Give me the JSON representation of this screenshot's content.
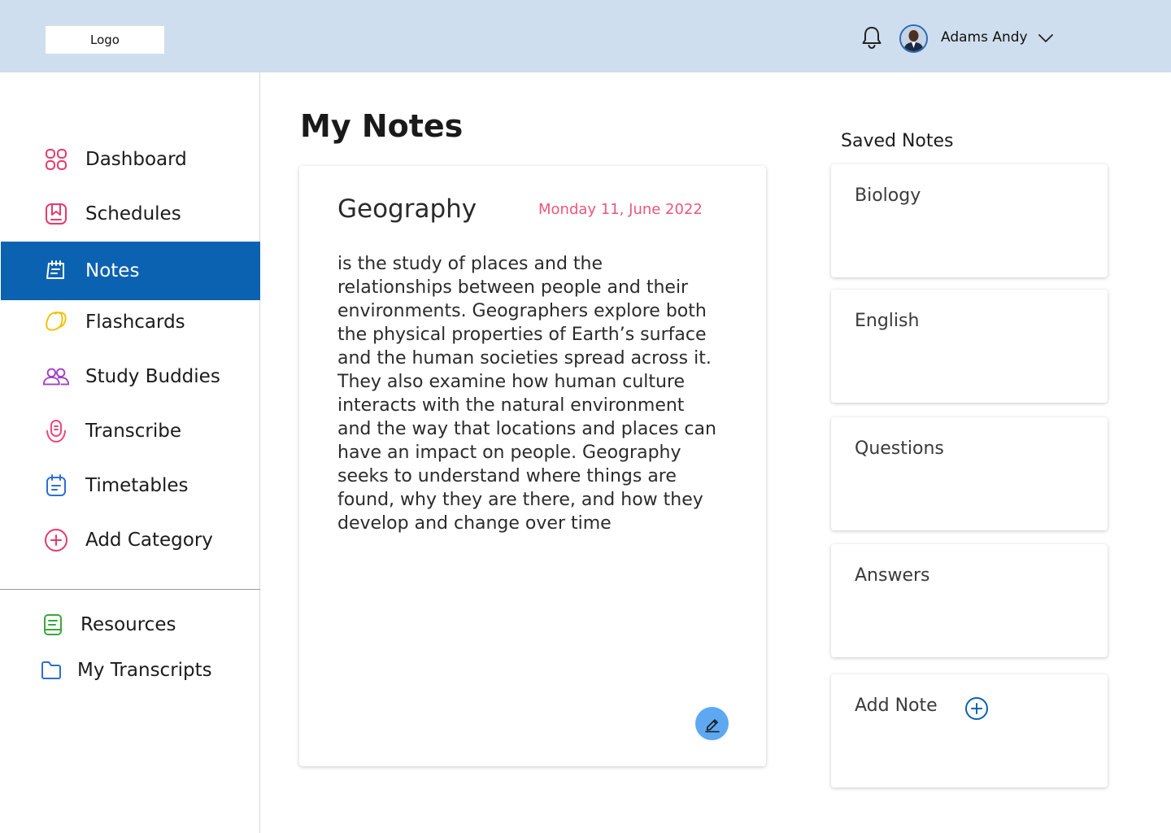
{
  "header": {
    "logo": "Logo",
    "user_name": "Adams Andy"
  },
  "sidebar": {
    "items": [
      {
        "label": "Dashboard",
        "icon": "grid-icon"
      },
      {
        "label": "Schedules",
        "icon": "calendar-bookmark-icon"
      },
      {
        "label": "Notes",
        "icon": "notes-icon"
      },
      {
        "label": "Flashcards",
        "icon": "flashcards-icon"
      },
      {
        "label": "Study Buddies",
        "icon": "people-icon"
      },
      {
        "label": "Transcribe",
        "icon": "microphone-icon"
      },
      {
        "label": "Timetables",
        "icon": "timetable-icon"
      },
      {
        "label": "Add Category",
        "icon": "plus-circle-icon"
      }
    ],
    "secondary": [
      {
        "label": "Resources",
        "icon": "book-icon"
      },
      {
        "label": "My Transcripts",
        "icon": "folder-icon"
      }
    ],
    "active_item": "Notes"
  },
  "main": {
    "page_title": "My Notes",
    "note": {
      "title": "Geography",
      "date": "Monday 11, June 2022",
      "body": "is the study of places and the relationships between people and their environments. Geographers explore both the physical properties of Earth’s surface and the human societies spread across it. They also examine how human culture interacts with the natural environment and the way that locations and places can have an impact on people. Geography seeks to understand where things are found, why they are there, and how they develop and change over time"
    }
  },
  "saved_notes": {
    "title": "Saved Notes",
    "items": [
      {
        "label": "Biology"
      },
      {
        "label": "English"
      },
      {
        "label": "Questions"
      },
      {
        "label": "Answers"
      }
    ],
    "add_label": "Add Note"
  },
  "colors": {
    "header_bg": "#cfdeee",
    "active_nav": "#0b62b1",
    "date_accent": "#e9577a",
    "edit_button": "#5ea8f2"
  }
}
